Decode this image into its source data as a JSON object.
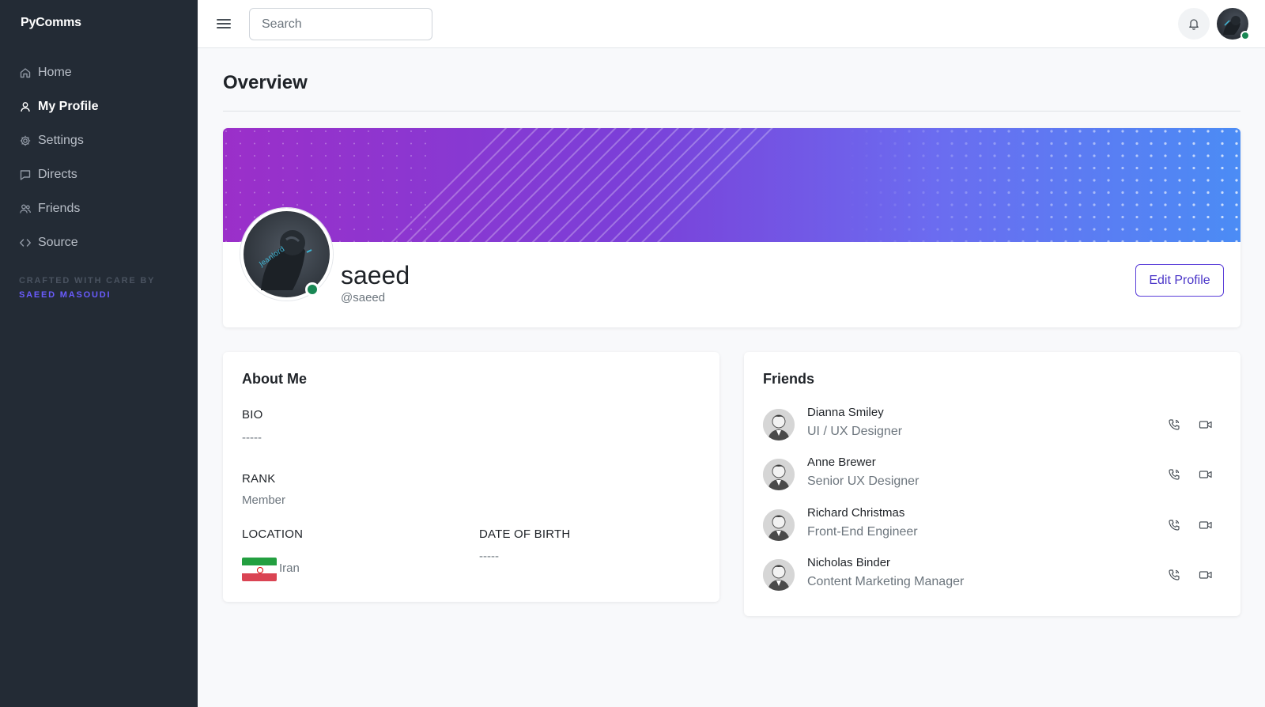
{
  "app": {
    "brand": "PyComms"
  },
  "sidebar": {
    "items": [
      {
        "label": "Home",
        "icon": "home-icon",
        "active": false
      },
      {
        "label": "My Profile",
        "icon": "user-icon",
        "active": true
      },
      {
        "label": "Settings",
        "icon": "gear-icon",
        "active": false
      },
      {
        "label": "Directs",
        "icon": "chat-icon",
        "active": false
      },
      {
        "label": "Friends",
        "icon": "users-icon",
        "active": false
      },
      {
        "label": "Source",
        "icon": "code-icon",
        "active": false
      }
    ],
    "crafted_by": "CRAFTED WITH CARE BY",
    "author": "SAEED MASOUDI"
  },
  "topbar": {
    "search_placeholder": "Search",
    "search_value": ""
  },
  "page": {
    "title": "Overview"
  },
  "profile": {
    "name": "saeed",
    "handle": "@saeed",
    "edit_label": "Edit Profile",
    "status": "online"
  },
  "about": {
    "title": "About Me",
    "bio_label": "BIO",
    "bio_value": "-----",
    "rank_label": "RANK",
    "rank_value": "Member",
    "location_label": "LOCATION",
    "location_value": "Iran",
    "dob_label": "DATE OF BIRTH",
    "dob_value": "-----"
  },
  "friends": {
    "title": "Friends",
    "list": [
      {
        "name": "Dianna Smiley",
        "role": "UI / UX Designer"
      },
      {
        "name": "Anne Brewer",
        "role": "Senior UX Designer"
      },
      {
        "name": "Richard Christmas",
        "role": "Front-End Engineer"
      },
      {
        "name": "Nicholas Binder",
        "role": "Content Marketing Manager"
      }
    ]
  },
  "colors": {
    "sidebar_bg": "#232b35",
    "accent": "#5b3fd9",
    "online": "#198754",
    "banner_start": "#9b2fc9",
    "banner_end": "#4b8cf5"
  }
}
